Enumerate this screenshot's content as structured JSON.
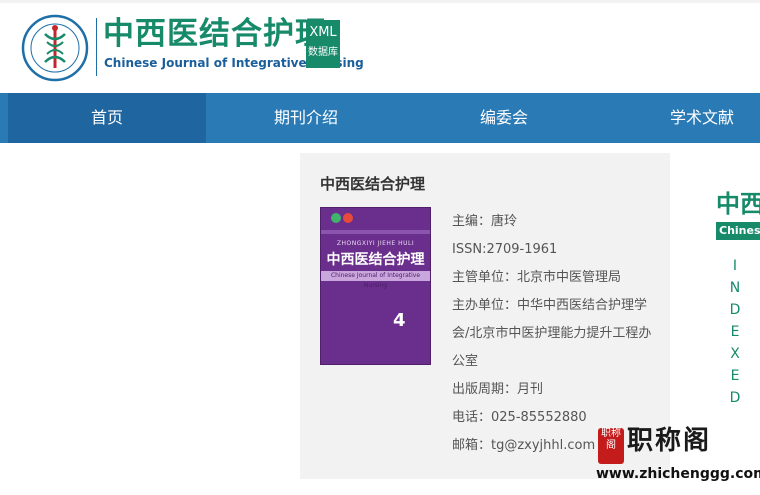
{
  "header": {
    "brand_cn": "中西医结合护理",
    "brand_en": "Chinese Journal of Integrative Nursing",
    "badge_top": "XML",
    "badge_bottom": "数据库"
  },
  "nav": {
    "items": [
      {
        "label": "首页",
        "active": true
      },
      {
        "label": "期刊介绍",
        "active": false
      },
      {
        "label": "编委会",
        "active": false
      },
      {
        "label": "学术文献",
        "active": false
      }
    ]
  },
  "card": {
    "title": "中西医结合护理",
    "cover": {
      "pinyin": "ZHONGXIYI JIEHE HULI",
      "title_cn": "中西医结合护理",
      "title_en": "Chinese Journal of Integrative Nursing",
      "issue_no": "4"
    },
    "info": [
      "主编：唐玲",
      "ISSN:2709-1961",
      "主管单位：北京市中医管理局",
      "主办单位：中华中西医结合护理学会/北京市中医护理能力提升工程办公室",
      "出版周期：月刊",
      "电话：025-85552880",
      "邮箱：tg@zxyjhhl.com"
    ]
  },
  "side": {
    "cn": "中西",
    "en": "Chinese",
    "vertical": [
      "I",
      "N",
      "D",
      "E",
      "X",
      "E",
      "D"
    ]
  },
  "watermark": {
    "seal": "职称阁",
    "text": "职称阁",
    "url": "www.zhichenggg.com"
  },
  "colors": {
    "nav_bg": "#2a7ab6",
    "nav_active": "#1f659f",
    "brand_green": "#178a6a",
    "card_bg": "#f2f2f2"
  }
}
